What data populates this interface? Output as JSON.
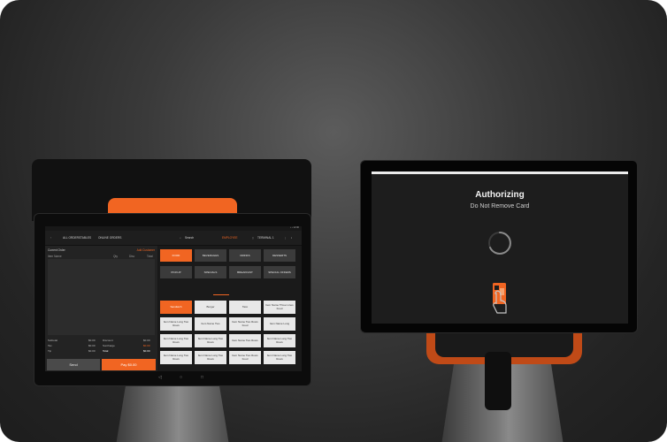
{
  "pos": {
    "status_text": "▪ ▪ 12:30",
    "nav": [
      "ALL ORDERS",
      "TABLES",
      "ONLINE ORDERS"
    ],
    "search_label": "Search",
    "employee_label": "EMPLOYEE",
    "terminal_label": "TERMINAL 1",
    "order": {
      "title": "Current Order",
      "action": "Add Customer",
      "columns": [
        "Item Name",
        "Qty",
        "Disc",
        "Total"
      ]
    },
    "totals": [
      {
        "label": "Subtotal",
        "value": "$0.00"
      },
      {
        "label": "Tax",
        "value": "$0.00"
      },
      {
        "label": "Tip",
        "value": "$0.00"
      },
      {
        "label": "Discount",
        "value": "$0.00"
      },
      {
        "label": "Surcharge",
        "value": "$0.00"
      },
      {
        "label": "Total",
        "value": "$0.00"
      }
    ],
    "send_label": "Send",
    "pay_label": "Pay $0.00",
    "categories": [
      "FOOD",
      "BEVERAGES",
      "DRINKS",
      "DESSERTS",
      "PICKUP",
      "SPECIALS",
      "BREAKFAST",
      "SPECIAL OFFERS"
    ],
    "items": [
      "Sandwich",
      "Burger",
      "Taco",
      "Item Name Three Lines Food",
      "Item Name Long Two Rows",
      "Item Name Two",
      "Item Name Two Rows Food",
      "Item Name Long",
      "Item Name Long Two Rows",
      "Item Name Long Two Rows",
      "Item Name Two Rows",
      "Item Name Long Two Rows",
      "Item Name Long Two Rows",
      "Item Name Long Two Rows",
      "Item Name Two Rows Food",
      "Item Name Long Two Rows"
    ],
    "nav_buttons": [
      "◁",
      "○",
      "□"
    ]
  },
  "display": {
    "title": "Authorizing",
    "subtitle": "Do Not Remove Card",
    "icons": [
      "loading-spinner-icon",
      "card-insert-icon"
    ]
  },
  "colors": {
    "accent": "#f16522",
    "screen_bg": "#1d1d1d",
    "backdrop": "#2a2a2a"
  }
}
